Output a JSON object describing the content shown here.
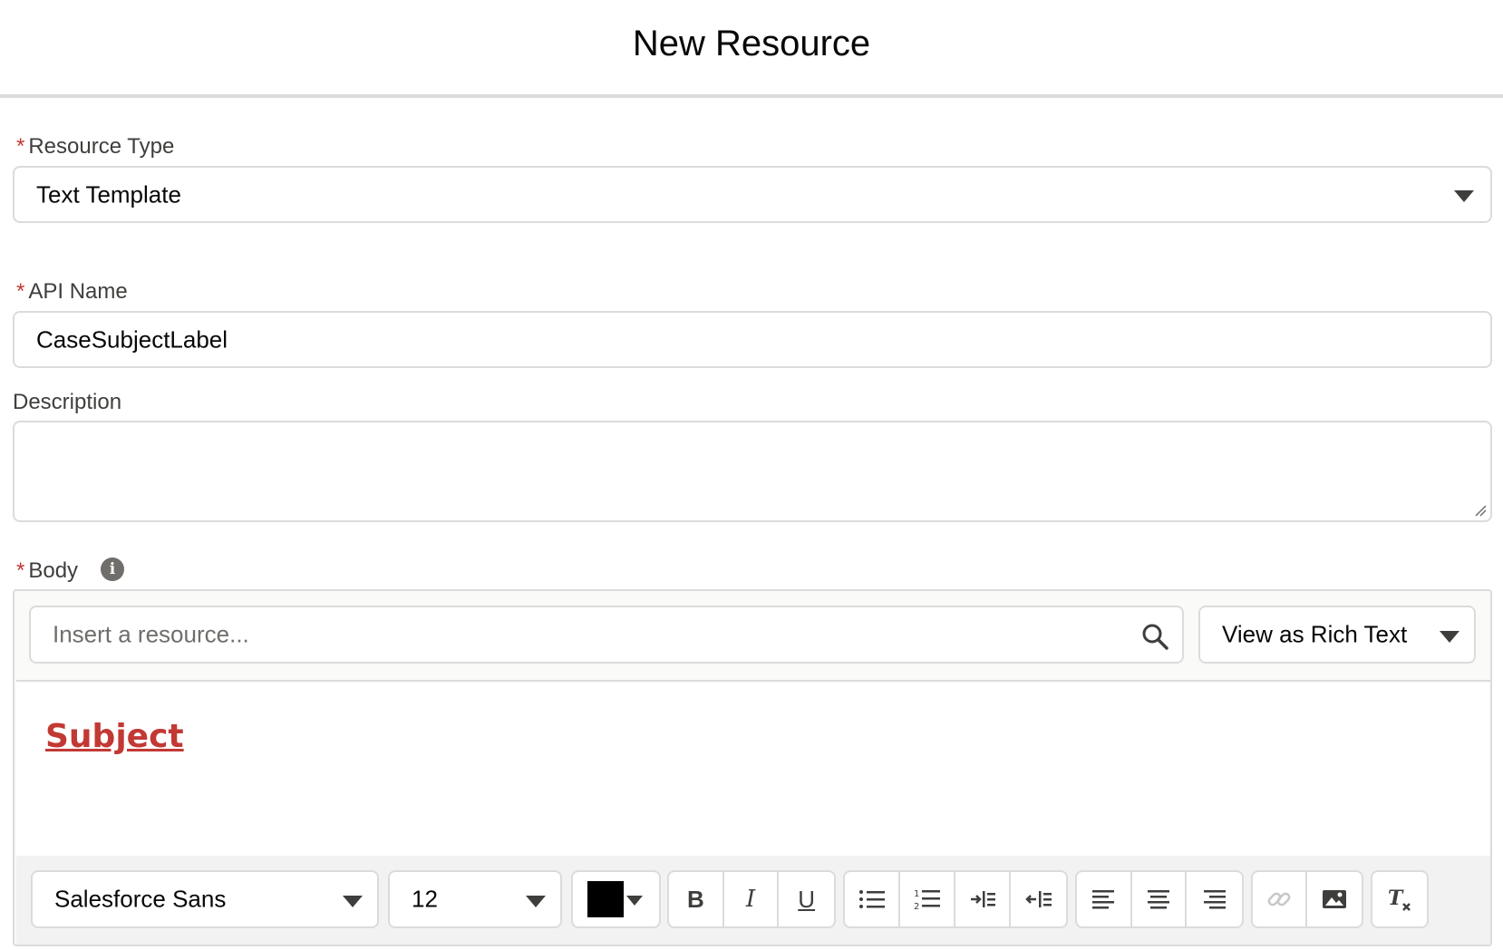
{
  "header": {
    "title": "New Resource"
  },
  "required_marker": "*",
  "resource_type": {
    "label": "Resource Type",
    "value": "Text Template"
  },
  "api_name": {
    "label": "API Name",
    "value": "CaseSubjectLabel"
  },
  "description": {
    "label": "Description",
    "value": ""
  },
  "body": {
    "label": "Body",
    "info_icon": "info-icon",
    "resource_search": {
      "placeholder": "Insert a resource...",
      "icon": "search-icon"
    },
    "view_mode": "View as Rich Text",
    "content": "Subject",
    "toolbar": {
      "font_family": "Salesforce Sans",
      "font_size": "12",
      "text_color": "#000000",
      "buttons": {
        "bold": "B",
        "italic": "I",
        "underline": "U",
        "bulleted_list": "bulleted-list-icon",
        "numbered_list": "numbered-list-icon",
        "indent": "indent-icon",
        "outdent": "outdent-icon",
        "align_left": "align-left-icon",
        "align_center": "align-center-icon",
        "align_right": "align-right-icon",
        "link": "link-icon",
        "image": "image-icon",
        "clear_formatting": "clear-formatting-icon"
      }
    }
  },
  "colors": {
    "required": "#c23934",
    "subject_text": "#c23934",
    "border": "#dddbda"
  }
}
